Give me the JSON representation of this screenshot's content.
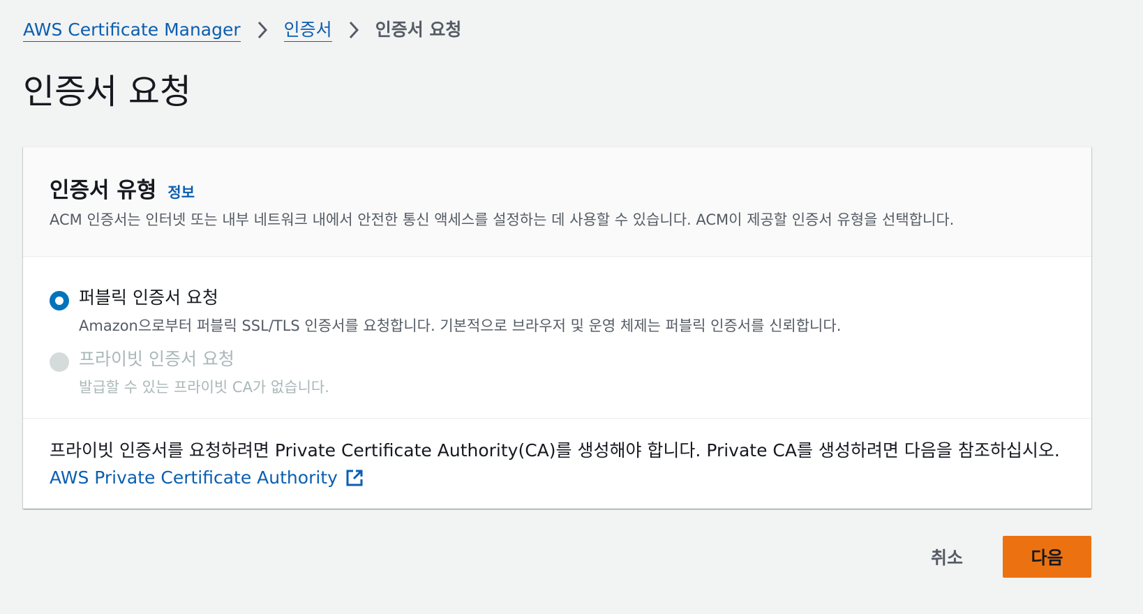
{
  "breadcrumb": {
    "items": [
      {
        "label": "AWS Certificate Manager"
      },
      {
        "label": "인증서"
      },
      {
        "label": "인증서 요청"
      }
    ]
  },
  "page": {
    "title": "인증서 요청"
  },
  "certificate_type": {
    "title": "인증서 유형",
    "info_label": "정보",
    "description": "ACM 인증서는 인터넷 또는 내부 네트워크 내에서 안전한 통신 액세스를 설정하는 데 사용할 수 있습니다. ACM이 제공할 인증서 유형을 선택합니다.",
    "options": [
      {
        "label": "퍼블릭 인증서 요청",
        "description": "Amazon으로부터 퍼블릭 SSL/TLS 인증서를 요청합니다. 기본적으로 브라우저 및 운영 체제는 퍼블릭 인증서를 신뢰합니다.",
        "selected": true,
        "disabled": false
      },
      {
        "label": "프라이빗 인증서 요청",
        "description": "발급할 수 있는 프라이빗 CA가 없습니다.",
        "selected": false,
        "disabled": true
      }
    ],
    "footer_text": "프라이빗 인증서를 요청하려면 Private Certificate Authority(CA)를 생성해야 합니다. Private CA를 생성하려면 다음을 참조하십시오.",
    "footer_link": "AWS Private Certificate Authority"
  },
  "actions": {
    "cancel_label": "취소",
    "next_label": "다음"
  },
  "colors": {
    "link": "#0a5eb0",
    "primary_button": "#ec7211",
    "radio_selected": "#0073bb",
    "radio_disabled": "#d5dbdb",
    "background": "#f2f3f3"
  },
  "icons": {
    "breadcrumb_separator": "chevron-right-icon",
    "external_link": "external-link-icon"
  }
}
